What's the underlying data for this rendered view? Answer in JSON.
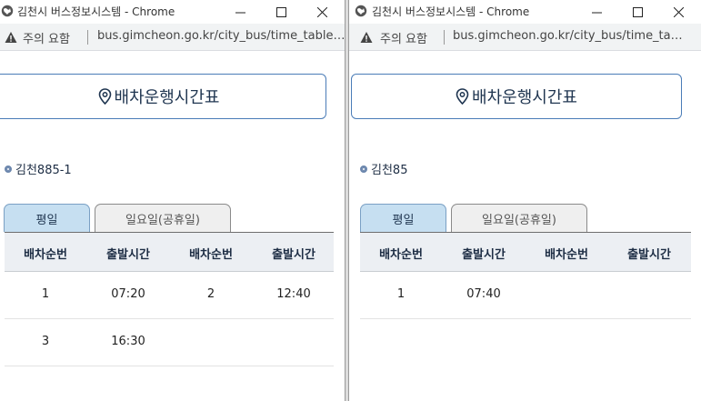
{
  "windows": [
    {
      "title": "김천시 버스정보시스템 - Chrome",
      "security_label": "주의 요함",
      "url": "bus.gimcheon.go.kr/city_bus/time_table.do",
      "page_title": "배차운행시간표",
      "route_name": "김천885-1",
      "tabs": [
        {
          "label": "평일",
          "active": true
        },
        {
          "label": "일요일(공휴일)",
          "active": false
        }
      ],
      "columns": [
        "배차순번",
        "출발시간",
        "배차순번",
        "출발시간"
      ],
      "rows": [
        [
          "1",
          "07:20",
          "2",
          "12:40"
        ],
        [
          "3",
          "16:30",
          "",
          ""
        ]
      ]
    },
    {
      "title": "김천시 버스정보시스템 - Chrome",
      "security_label": "주의 요함",
      "url": "bus.gimcheon.go.kr/city_bus/time_table.do",
      "page_title": "배차운행시간표",
      "route_name": "김천85",
      "tabs": [
        {
          "label": "평일",
          "active": true
        },
        {
          "label": "일요일(공휴일)",
          "active": false
        }
      ],
      "columns": [
        "배차순번",
        "출발시간",
        "배차순번",
        "출발시간"
      ],
      "rows": [
        [
          "1",
          "07:40",
          "",
          ""
        ]
      ]
    }
  ],
  "colors": {
    "accent_border": "#4a7cb7",
    "tab_active_bg": "#c6dff1",
    "table_header_bg": "#eceff3"
  },
  "icons": {
    "app": "globe-icon",
    "security": "warning-icon",
    "header": "map-pin-icon",
    "route": "bullet-icon"
  }
}
